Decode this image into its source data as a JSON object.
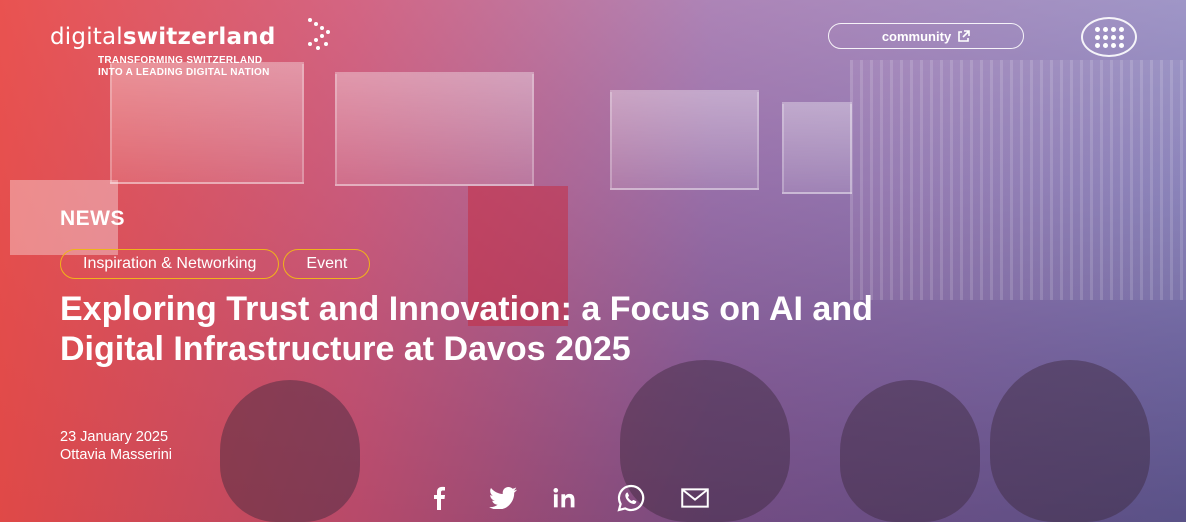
{
  "brand": {
    "name_light": "digital",
    "name_bold": "switzerland",
    "tagline_line1": "TRANSFORMING SWITZERLAND",
    "tagline_line2": "INTO A LEADING DIGITAL NATION"
  },
  "header": {
    "community_label": "community",
    "community_icon": "external-link-icon",
    "menu_icon": "grid-menu-icon"
  },
  "article": {
    "section": "NEWS",
    "tags": [
      "Inspiration & Networking",
      "Event"
    ],
    "title": "Exploring Trust and Innovation: a Focus on AI and Digital Infrastructure at Davos 2025",
    "date": "23 January 2025",
    "author": "Ottavia Masserini"
  },
  "share": {
    "icons": [
      "facebook-icon",
      "twitter-icon",
      "linkedin-icon",
      "whatsapp-icon",
      "email-icon"
    ]
  },
  "colors": {
    "accent_tag_border": "#f0b31a",
    "overlay_left": "#ec4a46",
    "overlay_right": "#6c6ec8"
  }
}
